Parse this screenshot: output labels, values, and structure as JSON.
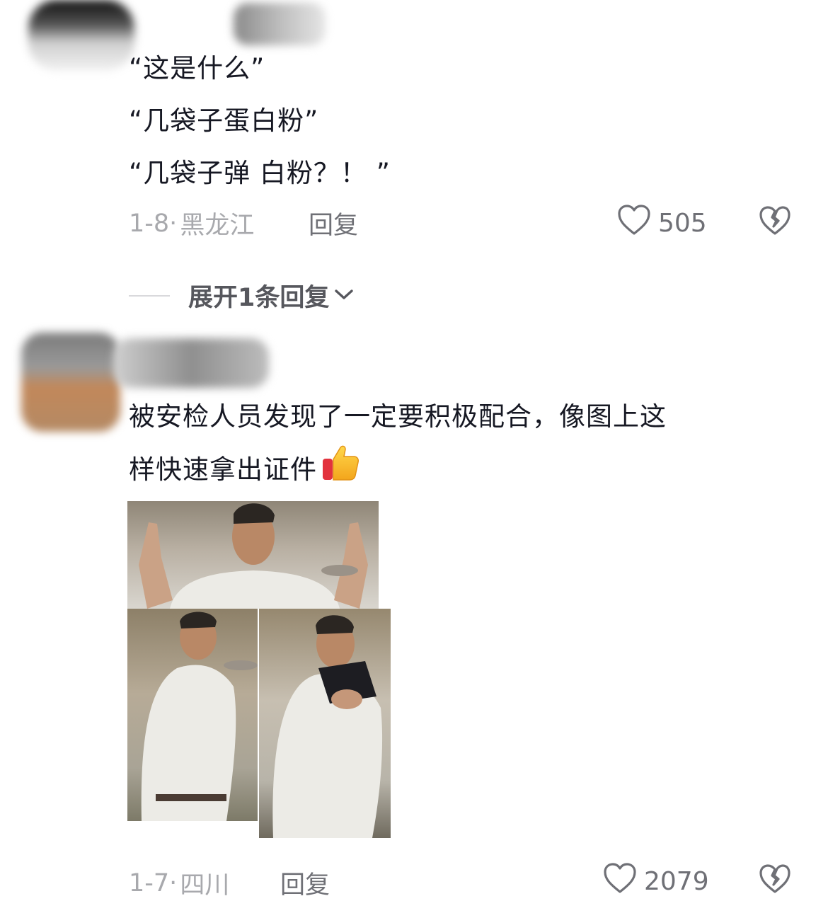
{
  "comments": [
    {
      "lines": [
        "“这是什么”",
        "“几袋子蛋白粉”",
        "“几袋子弹 白粉？！ ”"
      ],
      "date": "1-8",
      "location": "黑龙江",
      "reply_label": "回复",
      "likes": "505",
      "expand_label": "展开1条回复"
    },
    {
      "lines": [
        "被安检人员发现了一定要积极配合，像图上这",
        "样快速拿出证件"
      ],
      "date": "1-7",
      "location": "四川",
      "reply_label": "回复",
      "likes": "2079"
    }
  ],
  "colors": {
    "text": "#161823",
    "meta": "#a8a9ad",
    "action": "#6f7076",
    "background": "#ffffff"
  },
  "icons": [
    "heart-outline-icon",
    "broken-heart-icon",
    "chevron-down-icon",
    "thumbs-up-emoji"
  ]
}
